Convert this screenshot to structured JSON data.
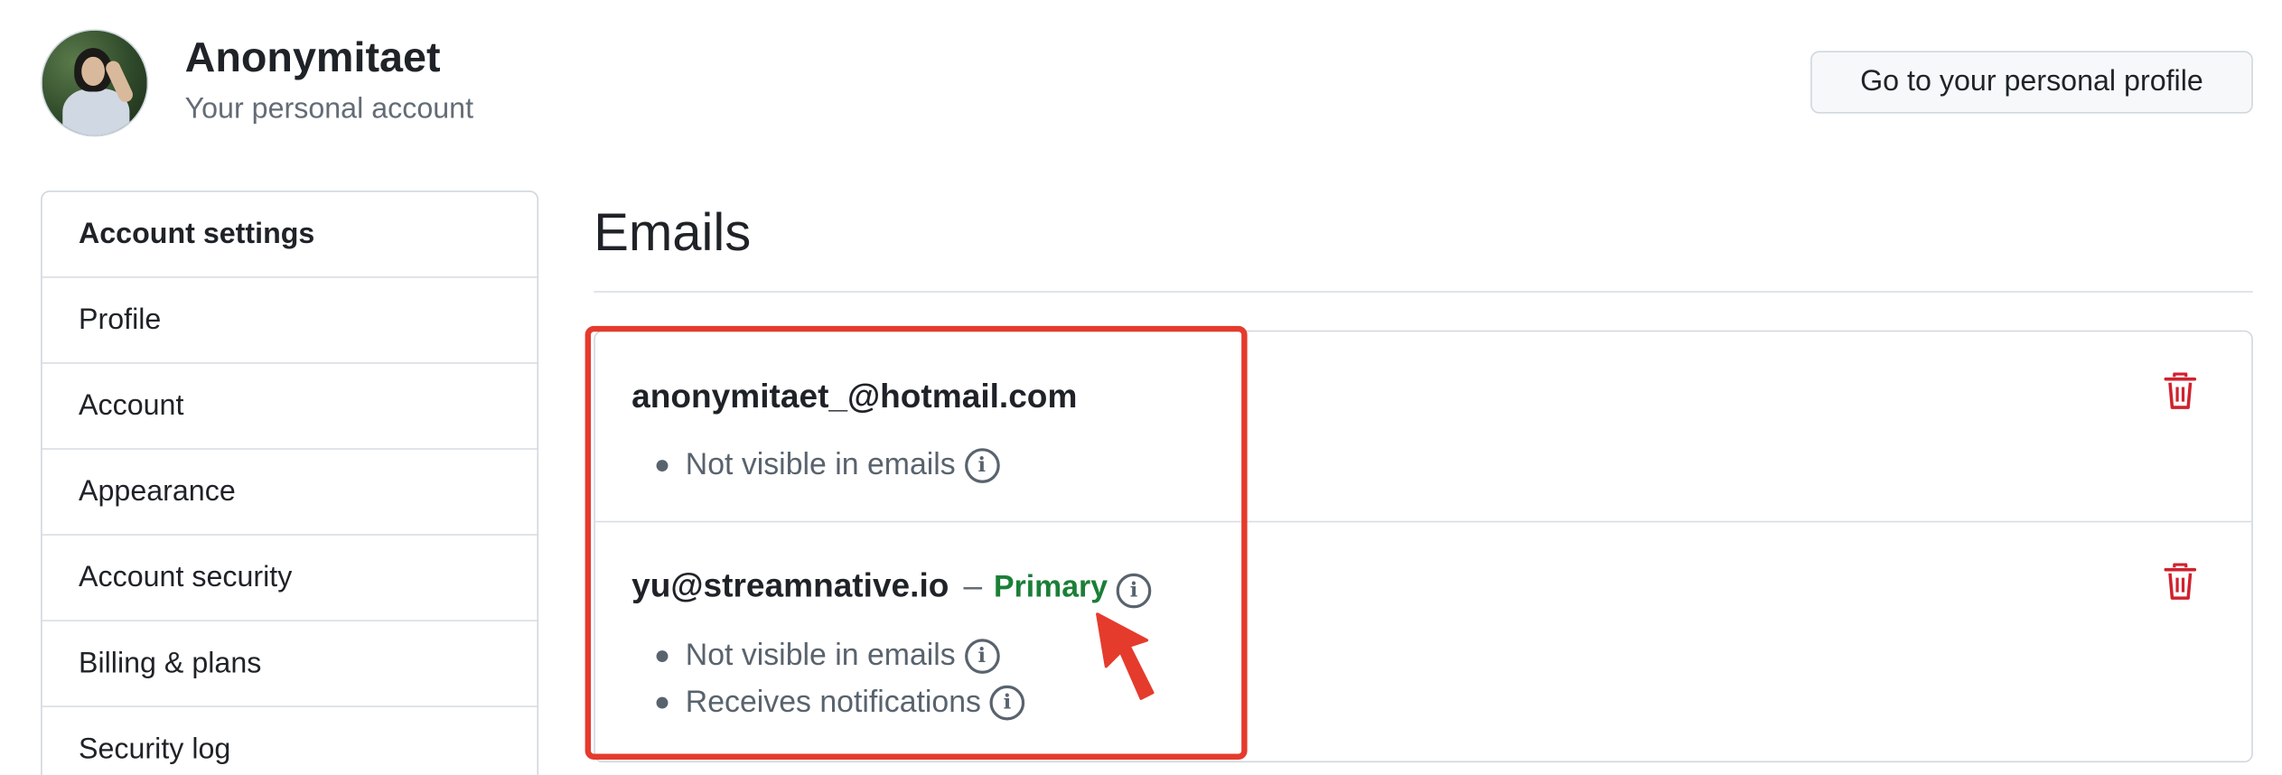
{
  "header": {
    "account_name": "Anonymitaet",
    "account_subtitle": "Your personal account",
    "profile_button": "Go to your personal profile"
  },
  "sidebar": {
    "items": [
      {
        "label": "Account settings"
      },
      {
        "label": "Profile"
      },
      {
        "label": "Account"
      },
      {
        "label": "Appearance"
      },
      {
        "label": "Account security"
      },
      {
        "label": "Billing & plans"
      },
      {
        "label": "Security log"
      }
    ]
  },
  "main": {
    "title": "Emails",
    "emails": [
      {
        "address": "anonymitaet_@hotmail.com",
        "details": [
          "Not visible in emails"
        ]
      },
      {
        "address": "yu@streamnative.io",
        "separator": "–",
        "badge": "Primary",
        "details": [
          "Not visible in emails",
          "Receives notifications"
        ]
      }
    ]
  },
  "icons": {
    "info": "info-icon",
    "trash": "trash-icon",
    "info_glyph": "i"
  },
  "colors": {
    "primary_badge": "#1a7f37",
    "danger": "#cf222e",
    "annotation": "#e53b2c"
  }
}
